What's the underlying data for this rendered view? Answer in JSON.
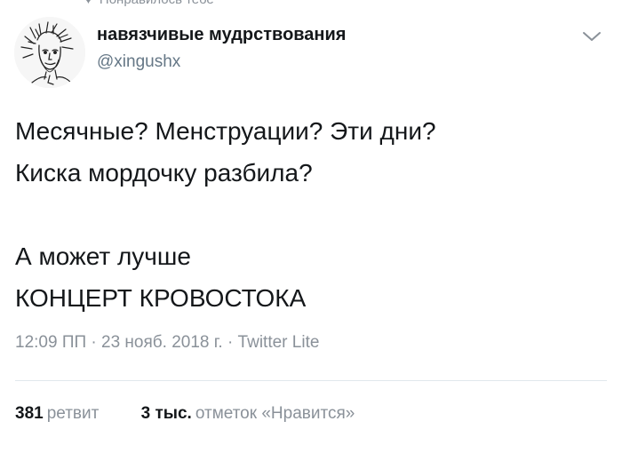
{
  "header_fragment": "Понравилось тебе",
  "account": {
    "name": "навязчивые мудрствования",
    "handle": "@xingushx",
    "avatar_icon": "sketch-portrait-avatar",
    "menu_icon": "chevron-down-icon"
  },
  "tweet": {
    "line1": "Месячные? Менструации? Эти дни?",
    "line2": "Киска мордочку разбила?",
    "line3": "А может лучше",
    "line4": "КОНЦЕРТ КРОВОСТОКА"
  },
  "meta": "12:09 ПП · 23 нояб. 2018 г. · Twitter Lite",
  "stats": {
    "retweets_count": "381",
    "retweets_label": "ретвит",
    "likes_count": "3 тыс.",
    "likes_label": "отметок «Нравится»"
  },
  "colors": {
    "text": "#14171a",
    "secondary": "#8a9199",
    "divider": "#e1e8ed"
  }
}
